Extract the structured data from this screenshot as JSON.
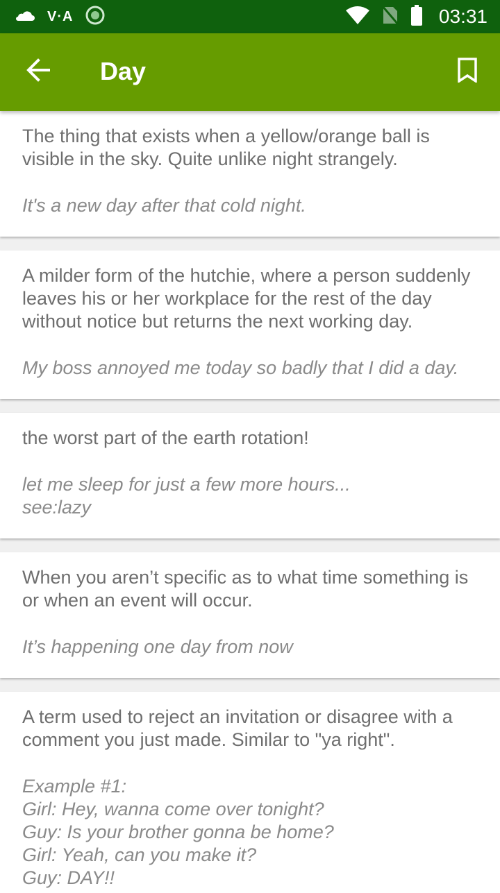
{
  "status_bar": {
    "vpn_label": "V·A",
    "time": "03:31",
    "icons": [
      "cloud-icon",
      "vpn-icon",
      "sync-icon",
      "wifi-icon",
      "no-sim-icon",
      "battery-icon"
    ]
  },
  "app_bar": {
    "title": "Day",
    "back_icon": "arrow-back-icon",
    "bookmark_icon": "bookmark-icon"
  },
  "colors": {
    "status_bar": "#0f610d",
    "app_bar": "#669c00",
    "background": "#f0f0f0",
    "text": "#6e6e6e"
  },
  "entries": [
    {
      "definition": "The thing that exists when a yellow/orange ball is visible in the sky.  Quite unlike night strangely.",
      "example": "It's a new day after that cold night."
    },
    {
      "definition": "A milder form of the hutchie, where a person suddenly leaves his or her workplace for the rest of the day without notice but returns the next working day.",
      "example": "My boss annoyed me today so badly that I did a day."
    },
    {
      "definition": "the worst part of the earth rotation!",
      "example": "let me sleep for just a few more hours...\nsee:lazy"
    },
    {
      "definition": "When you aren’t specific as to what time something is or when an event will occur.",
      "example": "It’s happening one day from now"
    },
    {
      "definition": "A term used to reject an invitation or disagree with a comment you just made. Similar to \"ya right\".",
      "example": "Example #1:\nGirl: Hey, wanna come over tonight?\nGuy: Is your brother gonna be home?\nGirl: Yeah, can you make it?\nGuy: DAY!!"
    }
  ]
}
